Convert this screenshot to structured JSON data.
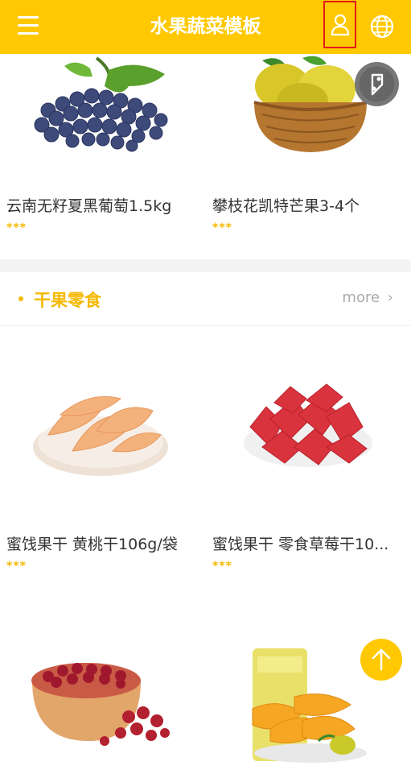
{
  "header": {
    "title": "水果蔬菜模板"
  },
  "icons": {
    "menu": "menu-icon",
    "user": "user-icon",
    "globe": "globe-icon",
    "map": "map-pin-icon",
    "top": "arrow-up-icon"
  },
  "products_row1": [
    {
      "name": "云南无籽夏黑葡萄1.5kg",
      "rating": "***"
    },
    {
      "name": "攀枝花凯特芒果3-4个",
      "rating": "***"
    }
  ],
  "section": {
    "title": "干果零食",
    "more": "more"
  },
  "products_row2": [
    {
      "name": "蜜饯果干 黄桃干106g/袋",
      "rating": "***"
    },
    {
      "name": "蜜饯果干 零食草莓干10...",
      "rating": "***"
    }
  ],
  "products_row3": [
    {
      "name": "",
      "rating": ""
    },
    {
      "name": "",
      "rating": ""
    }
  ],
  "colors": {
    "brand": "#ffc800",
    "accent": "#f5b800",
    "highlight_box": "#e21b1b"
  }
}
